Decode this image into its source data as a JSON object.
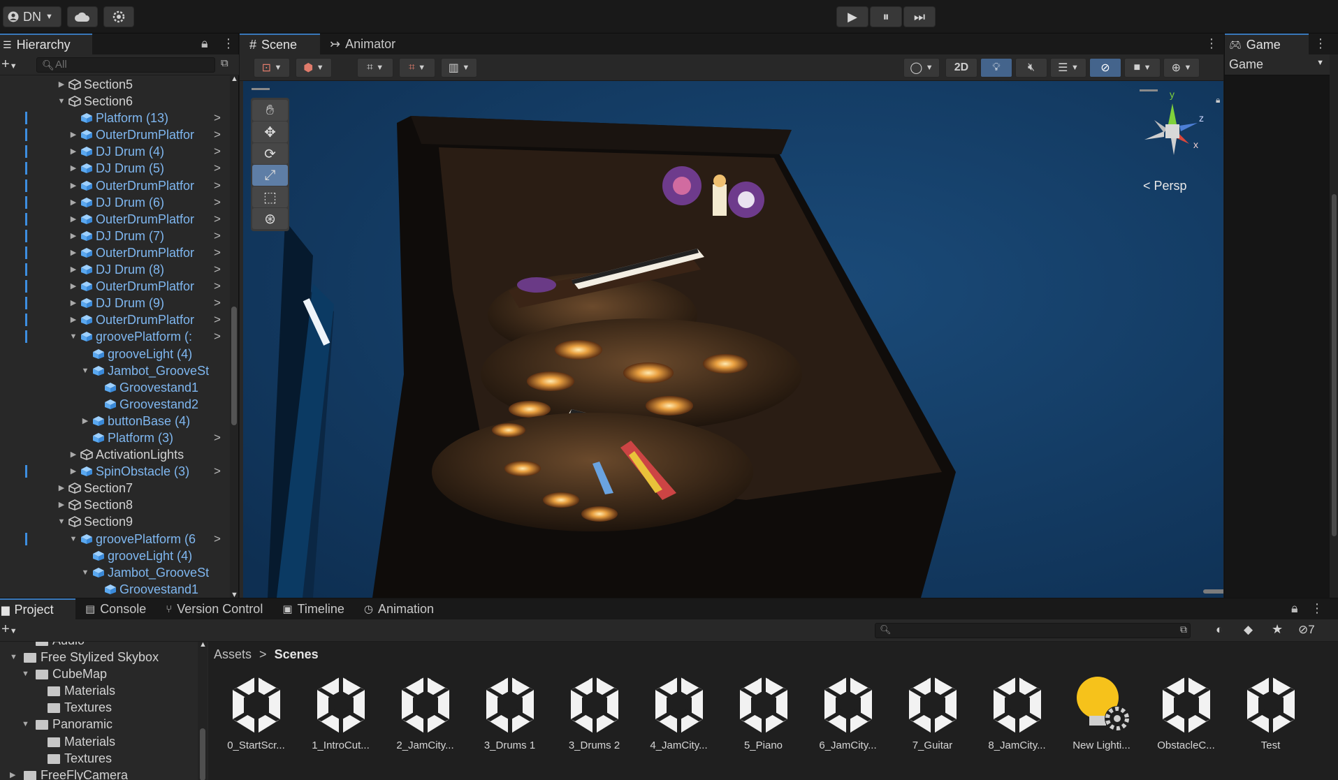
{
  "toolbar": {
    "account": "DN",
    "play": "▶",
    "pause": "⏸",
    "step": "⏭"
  },
  "hierarchy": {
    "tab": "Hierarchy",
    "search_placeholder": "All",
    "rows": [
      {
        "label": "Section5",
        "depth": 0,
        "arrow": "▶",
        "prefab": false,
        "bar": false,
        "more": false
      },
      {
        "label": "Section6",
        "depth": 0,
        "arrow": "▼",
        "prefab": false,
        "bar": false,
        "more": false
      },
      {
        "label": "Platform (13)",
        "depth": 1,
        "arrow": "",
        "prefab": true,
        "bar": true,
        "more": true
      },
      {
        "label": "OuterDrumPlatfor",
        "depth": 1,
        "arrow": "▶",
        "prefab": true,
        "bar": true,
        "more": true
      },
      {
        "label": "DJ Drum (4)",
        "depth": 1,
        "arrow": "▶",
        "prefab": true,
        "bar": true,
        "more": true
      },
      {
        "label": "DJ Drum (5)",
        "depth": 1,
        "arrow": "▶",
        "prefab": true,
        "bar": true,
        "more": true
      },
      {
        "label": "OuterDrumPlatfor",
        "depth": 1,
        "arrow": "▶",
        "prefab": true,
        "bar": true,
        "more": true
      },
      {
        "label": "DJ Drum (6)",
        "depth": 1,
        "arrow": "▶",
        "prefab": true,
        "bar": true,
        "more": true
      },
      {
        "label": "OuterDrumPlatfor",
        "depth": 1,
        "arrow": "▶",
        "prefab": true,
        "bar": true,
        "more": true
      },
      {
        "label": "DJ Drum (7)",
        "depth": 1,
        "arrow": "▶",
        "prefab": true,
        "bar": true,
        "more": true
      },
      {
        "label": "OuterDrumPlatfor",
        "depth": 1,
        "arrow": "▶",
        "prefab": true,
        "bar": true,
        "more": true
      },
      {
        "label": "DJ Drum (8)",
        "depth": 1,
        "arrow": "▶",
        "prefab": true,
        "bar": true,
        "more": true
      },
      {
        "label": "OuterDrumPlatfor",
        "depth": 1,
        "arrow": "▶",
        "prefab": true,
        "bar": true,
        "more": true
      },
      {
        "label": "DJ Drum (9)",
        "depth": 1,
        "arrow": "▶",
        "prefab": true,
        "bar": true,
        "more": true
      },
      {
        "label": "OuterDrumPlatfor",
        "depth": 1,
        "arrow": "▶",
        "prefab": true,
        "bar": true,
        "more": true
      },
      {
        "label": "groovePlatform (:",
        "depth": 1,
        "arrow": "▼",
        "prefab": true,
        "bar": true,
        "more": true
      },
      {
        "label": "grooveLight (4)",
        "depth": 2,
        "arrow": "",
        "prefab": true,
        "bar": false,
        "more": false
      },
      {
        "label": "Jambot_GrooveSt",
        "depth": 2,
        "arrow": "▼",
        "prefab": true,
        "bar": false,
        "more": false
      },
      {
        "label": "Groovestand1",
        "depth": 3,
        "arrow": "",
        "prefab": true,
        "bar": false,
        "more": false
      },
      {
        "label": "Groovestand2",
        "depth": 3,
        "arrow": "",
        "prefab": true,
        "bar": false,
        "more": false
      },
      {
        "label": "buttonBase (4)",
        "depth": 2,
        "arrow": "▶",
        "prefab": true,
        "bar": false,
        "more": false
      },
      {
        "label": "Platform (3)",
        "depth": 2,
        "arrow": "",
        "prefab": true,
        "bar": false,
        "more": true
      },
      {
        "label": "ActivationLights",
        "depth": 1,
        "arrow": "▶",
        "prefab": false,
        "bar": false,
        "more": false
      },
      {
        "label": "SpinObstacle (3)",
        "depth": 1,
        "arrow": "▶",
        "prefab": true,
        "bar": true,
        "more": true
      },
      {
        "label": "Section7",
        "depth": 0,
        "arrow": "▶",
        "prefab": false,
        "bar": false,
        "more": false
      },
      {
        "label": "Section8",
        "depth": 0,
        "arrow": "▶",
        "prefab": false,
        "bar": false,
        "more": false
      },
      {
        "label": "Section9",
        "depth": 0,
        "arrow": "▼",
        "prefab": false,
        "bar": false,
        "more": false
      },
      {
        "label": "groovePlatform (6",
        "depth": 1,
        "arrow": "▼",
        "prefab": true,
        "bar": true,
        "more": true
      },
      {
        "label": "grooveLight (4)",
        "depth": 2,
        "arrow": "",
        "prefab": true,
        "bar": false,
        "more": false
      },
      {
        "label": "Jambot_GrooveSt",
        "depth": 2,
        "arrow": "▼",
        "prefab": true,
        "bar": false,
        "more": false
      },
      {
        "label": "Groovestand1",
        "depth": 3,
        "arrow": "",
        "prefab": true,
        "bar": false,
        "more": false
      }
    ]
  },
  "scene": {
    "tab_scene": "Scene",
    "tab_animator": "Animator",
    "btn_2d": "2D",
    "persp_label": "Persp",
    "axis_y": "y",
    "axis_z": "z",
    "axis_x": "x"
  },
  "game": {
    "tab": "Game",
    "dropdown": "Game"
  },
  "project": {
    "tabs": [
      "Project",
      "Console",
      "Version Control",
      "Timeline",
      "Animation"
    ],
    "hidden_count": "7",
    "tree": [
      {
        "label": "Audio",
        "depth": 1,
        "arrow": ""
      },
      {
        "label": "Free Stylized Skybox",
        "depth": 0,
        "arrow": "▼"
      },
      {
        "label": "CubeMap",
        "depth": 1,
        "arrow": "▼"
      },
      {
        "label": "Materials",
        "depth": 2,
        "arrow": ""
      },
      {
        "label": "Textures",
        "depth": 2,
        "arrow": ""
      },
      {
        "label": "Panoramic",
        "depth": 1,
        "arrow": "▼"
      },
      {
        "label": "Materials",
        "depth": 2,
        "arrow": ""
      },
      {
        "label": "Textures",
        "depth": 2,
        "arrow": ""
      },
      {
        "label": "FreeFlyCamera",
        "depth": 0,
        "arrow": "▶"
      }
    ],
    "breadcrumb_root": "Assets",
    "breadcrumb_sep": ">",
    "breadcrumb_current": "Scenes",
    "assets": [
      {
        "name": "0_StartScr...",
        "kind": "scene"
      },
      {
        "name": "1_IntroCut...",
        "kind": "scene"
      },
      {
        "name": "2_JamCity...",
        "kind": "scene"
      },
      {
        "name": "3_Drums 1",
        "kind": "scene"
      },
      {
        "name": "3_Drums 2",
        "kind": "scene"
      },
      {
        "name": "4_JamCity...",
        "kind": "scene"
      },
      {
        "name": "5_Piano",
        "kind": "scene"
      },
      {
        "name": "6_JamCity...",
        "kind": "scene"
      },
      {
        "name": "7_Guitar",
        "kind": "scene"
      },
      {
        "name": "8_JamCity...",
        "kind": "scene"
      },
      {
        "name": "New Lighti...",
        "kind": "lighting"
      },
      {
        "name": "ObstacleC...",
        "kind": "scene"
      },
      {
        "name": "Test",
        "kind": "scene"
      }
    ]
  },
  "colors": {
    "accent": "#3a79bb",
    "prefab_text": "#7fb7f0",
    "scene_sky": "#133b63"
  }
}
